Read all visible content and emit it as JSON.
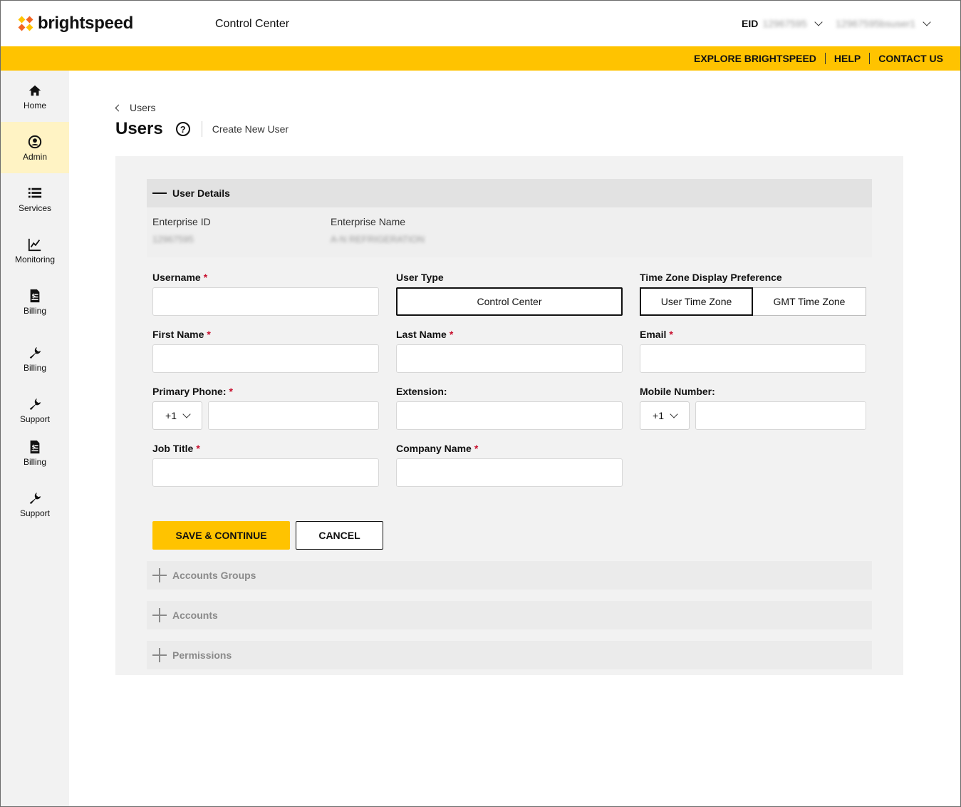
{
  "header": {
    "brand": "brightspeed",
    "app_title": "Control Center",
    "eid_label": "EID",
    "eid_value": "12967595",
    "username": "12967595bsuser1"
  },
  "top_nav": {
    "explore": "EXPLORE BRIGHTSPEED",
    "help": "HELP",
    "contact": "CONTACT US"
  },
  "colors": {
    "accent": "#ffc300",
    "required": "#c8102e",
    "sidebar_active": "#fff3c4"
  },
  "sidebar": {
    "items": [
      {
        "label": "Home",
        "icon": "home-icon"
      },
      {
        "label": "Admin",
        "icon": "user-circle-icon",
        "active": true
      },
      {
        "label": "Services",
        "icon": "list-icon"
      },
      {
        "label": "Monitoring",
        "icon": "chart-line-icon"
      },
      {
        "label": "Billing",
        "icon": "invoice-icon"
      },
      {
        "label": "Billing",
        "icon": "wrench-icon"
      },
      {
        "label": "Support",
        "icon": "wrench-icon"
      },
      {
        "label": "Billing",
        "icon": "invoice-icon"
      },
      {
        "label": "Support",
        "icon": "wrench-icon"
      }
    ]
  },
  "breadcrumb": {
    "back_label": "Users"
  },
  "page": {
    "title": "Users",
    "help_glyph": "?",
    "subtitle": "Create New User"
  },
  "user_details": {
    "section_title": "User Details",
    "enterprise_id_label": "Enterprise ID",
    "enterprise_id_value": "12967595",
    "enterprise_name_label": "Enterprise Name",
    "enterprise_name_value": "A-N REFRIGERATION",
    "fields": {
      "username": "Username",
      "user_type": "User Type",
      "user_type_value": "Control Center",
      "timezone": "Time Zone Display Preference",
      "tz_user": "User Time Zone",
      "tz_gmt": "GMT Time Zone",
      "first_name": "First Name",
      "last_name": "Last Name",
      "email": "Email",
      "primary_phone": "Primary Phone:",
      "extension": "Extension:",
      "mobile_number": "Mobile Number:",
      "country_code": "+1",
      "job_title": "Job Title",
      "company_name": "Company Name"
    },
    "required_mark": "*"
  },
  "actions": {
    "save": "SAVE & CONTINUE",
    "cancel": "CANCEL"
  },
  "collapsed_sections": {
    "accounts_groups": "Accounts Groups",
    "accounts": "Accounts",
    "permissions": "Permissions"
  }
}
